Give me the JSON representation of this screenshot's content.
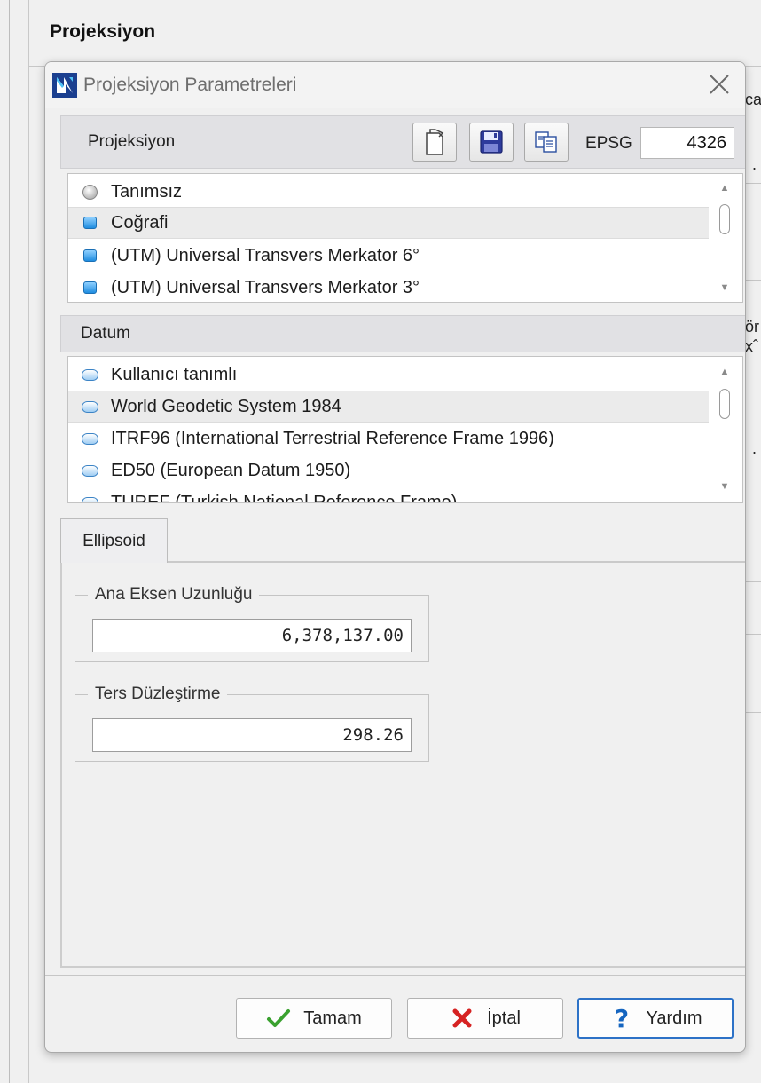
{
  "background": {
    "heading": "Projeksiyon",
    "right_fragments": [
      "ca",
      ".",
      "ör",
      "xˆ",
      "."
    ]
  },
  "dialog": {
    "title": "Projeksiyon Parametreleri",
    "icons": {
      "app": "app-logo-icon",
      "close": "close-icon"
    }
  },
  "projection_panel": {
    "label": "Projeksiyon",
    "toolbar": [
      {
        "name": "open-projection-button",
        "icon": "open-file-icon"
      },
      {
        "name": "save-projection-button",
        "icon": "floppy-disk-icon"
      },
      {
        "name": "copy-projection-button",
        "icon": "copy-icon"
      }
    ],
    "epsg_label": "EPSG",
    "epsg_value": "4326",
    "items": [
      {
        "label": "Tanımsız",
        "bullet": "radio",
        "selected": false
      },
      {
        "label": "Coğrafi",
        "bullet": "square",
        "selected": true
      },
      {
        "label": "(UTM) Universal Transvers Merkator 6°",
        "bullet": "square",
        "selected": false
      },
      {
        "label": "(UTM) Universal Transvers Merkator 3°",
        "bullet": "square",
        "selected": false
      }
    ]
  },
  "datum_panel": {
    "label": "Datum",
    "items": [
      {
        "label": "Kullanıcı tanımlı",
        "selected": false
      },
      {
        "label": "World Geodetic System 1984",
        "selected": true
      },
      {
        "label": "ITRF96 (International Terrestrial Reference Frame 1996)",
        "selected": false
      },
      {
        "label": "ED50 (European Datum 1950)",
        "selected": false
      },
      {
        "label": "TUREF (Turkish National Reference Frame)",
        "selected": false
      }
    ]
  },
  "ellipsoid": {
    "tab_label": "Ellipsoid",
    "semi_major_label": "Ana Eksen Uzunluğu",
    "semi_major_value": "6,378,137.00",
    "inverse_flattening_label": "Ters Düzleştirme",
    "inverse_flattening_value": "298.26"
  },
  "buttons": {
    "ok": {
      "label": "Tamam",
      "icon": "checkmark-icon",
      "color": "#3aa12f"
    },
    "cancel": {
      "label": "İptal",
      "icon": "cross-icon",
      "color": "#d62222"
    },
    "help": {
      "label": "Yardım",
      "icon": "question-icon",
      "color": "#1565c0"
    }
  }
}
